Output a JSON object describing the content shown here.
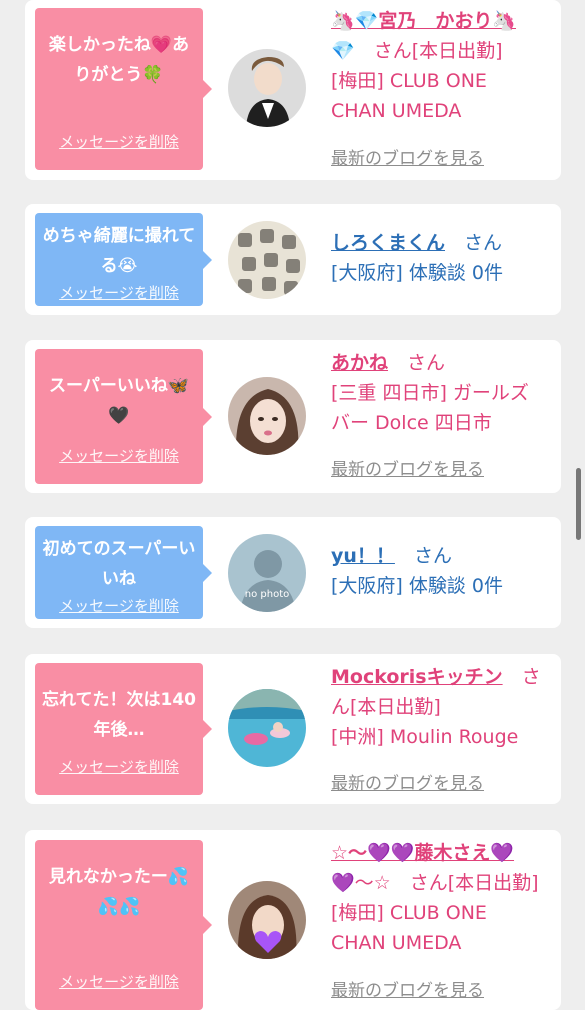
{
  "messages": [
    {
      "bubble_text": "楽しかったね💗ありがとう🍀",
      "delete_label": "メッセージを削除",
      "name_line1": "🦄💎宮乃　かおり🦄",
      "name_line2": "💎",
      "honorific": "さん[本日出勤]",
      "location_line1": "[梅田] CLUB ONE",
      "location_line2": "CHAN UMEDA",
      "blog_label": "最新のブログを見る"
    },
    {
      "bubble_text": "めちゃ綺麗に撮れてる😭",
      "delete_label": "メッセージを削除",
      "name_line1": "しろくまくん",
      "honorific": "さん",
      "location_line1": "[大阪府] 体験談 0件"
    },
    {
      "bubble_text": "スーパーいいね🦋🖤",
      "delete_label": "メッセージを削除",
      "name_line1": "あかね",
      "honorific": "さん",
      "location_line1": "[三重 四日市] ガールズ",
      "location_line2": "バー Dolce 四日市",
      "blog_label": "最新のブログを見る"
    },
    {
      "bubble_text": "初めてのスーパーいいね",
      "delete_label": "メッセージを削除",
      "name_line1": "yu！！",
      "honorific": "さん",
      "location_line1": "[大阪府] 体験談 0件",
      "avatar_text": "no photo"
    },
    {
      "bubble_text": "忘れてた！次は140年後…",
      "delete_label": "メッセージを削除",
      "name_line1": "Mockorisキッチン",
      "honorific": "さ",
      "honorific_line2": "ん[本日出勤]",
      "location_line1": "[中洲] Moulin Rouge",
      "blog_label": "最新のブログを見る"
    },
    {
      "bubble_text": "見れなかったー💦💦💦",
      "delete_label": "メッセージを削除",
      "name_line1": "☆〜💜💜藤木さえ💜",
      "name_line2": "💜〜☆",
      "honorific": "さん[本日出勤]",
      "location_line1": "[梅田] CLUB ONE",
      "location_line2": "CHAN UMEDA",
      "blog_label": "最新のブログを見る"
    }
  ],
  "colors": {
    "pink": "#f98ea4",
    "blue": "#7fb7f5",
    "pink_text": "#e0427a",
    "blue_text": "#2c6fb6"
  },
  "icons": {
    "scrollbar": "scrollbar-thumb"
  }
}
